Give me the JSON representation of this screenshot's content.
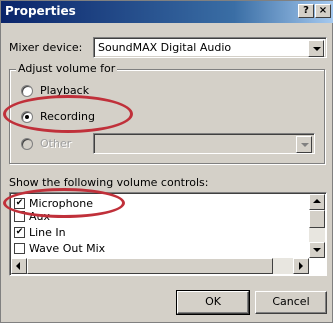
{
  "window": {
    "title": "Properties",
    "help_label": "?",
    "close_label": "×"
  },
  "mixer": {
    "label": "Mixer device:",
    "value": "SoundMAX Digital Audio"
  },
  "adjust_volume": {
    "group_title": "Adjust volume for",
    "options": [
      {
        "label": "Playback",
        "checked": false,
        "enabled": true
      },
      {
        "label": "Recording",
        "checked": true,
        "enabled": true
      },
      {
        "label": "Other",
        "checked": false,
        "enabled": false
      }
    ],
    "other_select_value": ""
  },
  "volume_controls": {
    "label": "Show the following volume controls:",
    "items": [
      {
        "label": "Microphone",
        "checked": true
      },
      {
        "label": "Aux",
        "checked": false
      },
      {
        "label": "Line In",
        "checked": true
      },
      {
        "label": "Wave Out Mix",
        "checked": false
      }
    ]
  },
  "buttons": {
    "ok": "OK",
    "cancel": "Cancel"
  },
  "highlight_color": "#c0303a",
  "check_glyph": "✔",
  "icons": [
    "help-icon",
    "close-icon",
    "chevron-down-icon",
    "scroll-up-icon",
    "scroll-down-icon",
    "scroll-left-icon",
    "scroll-right-icon"
  ]
}
